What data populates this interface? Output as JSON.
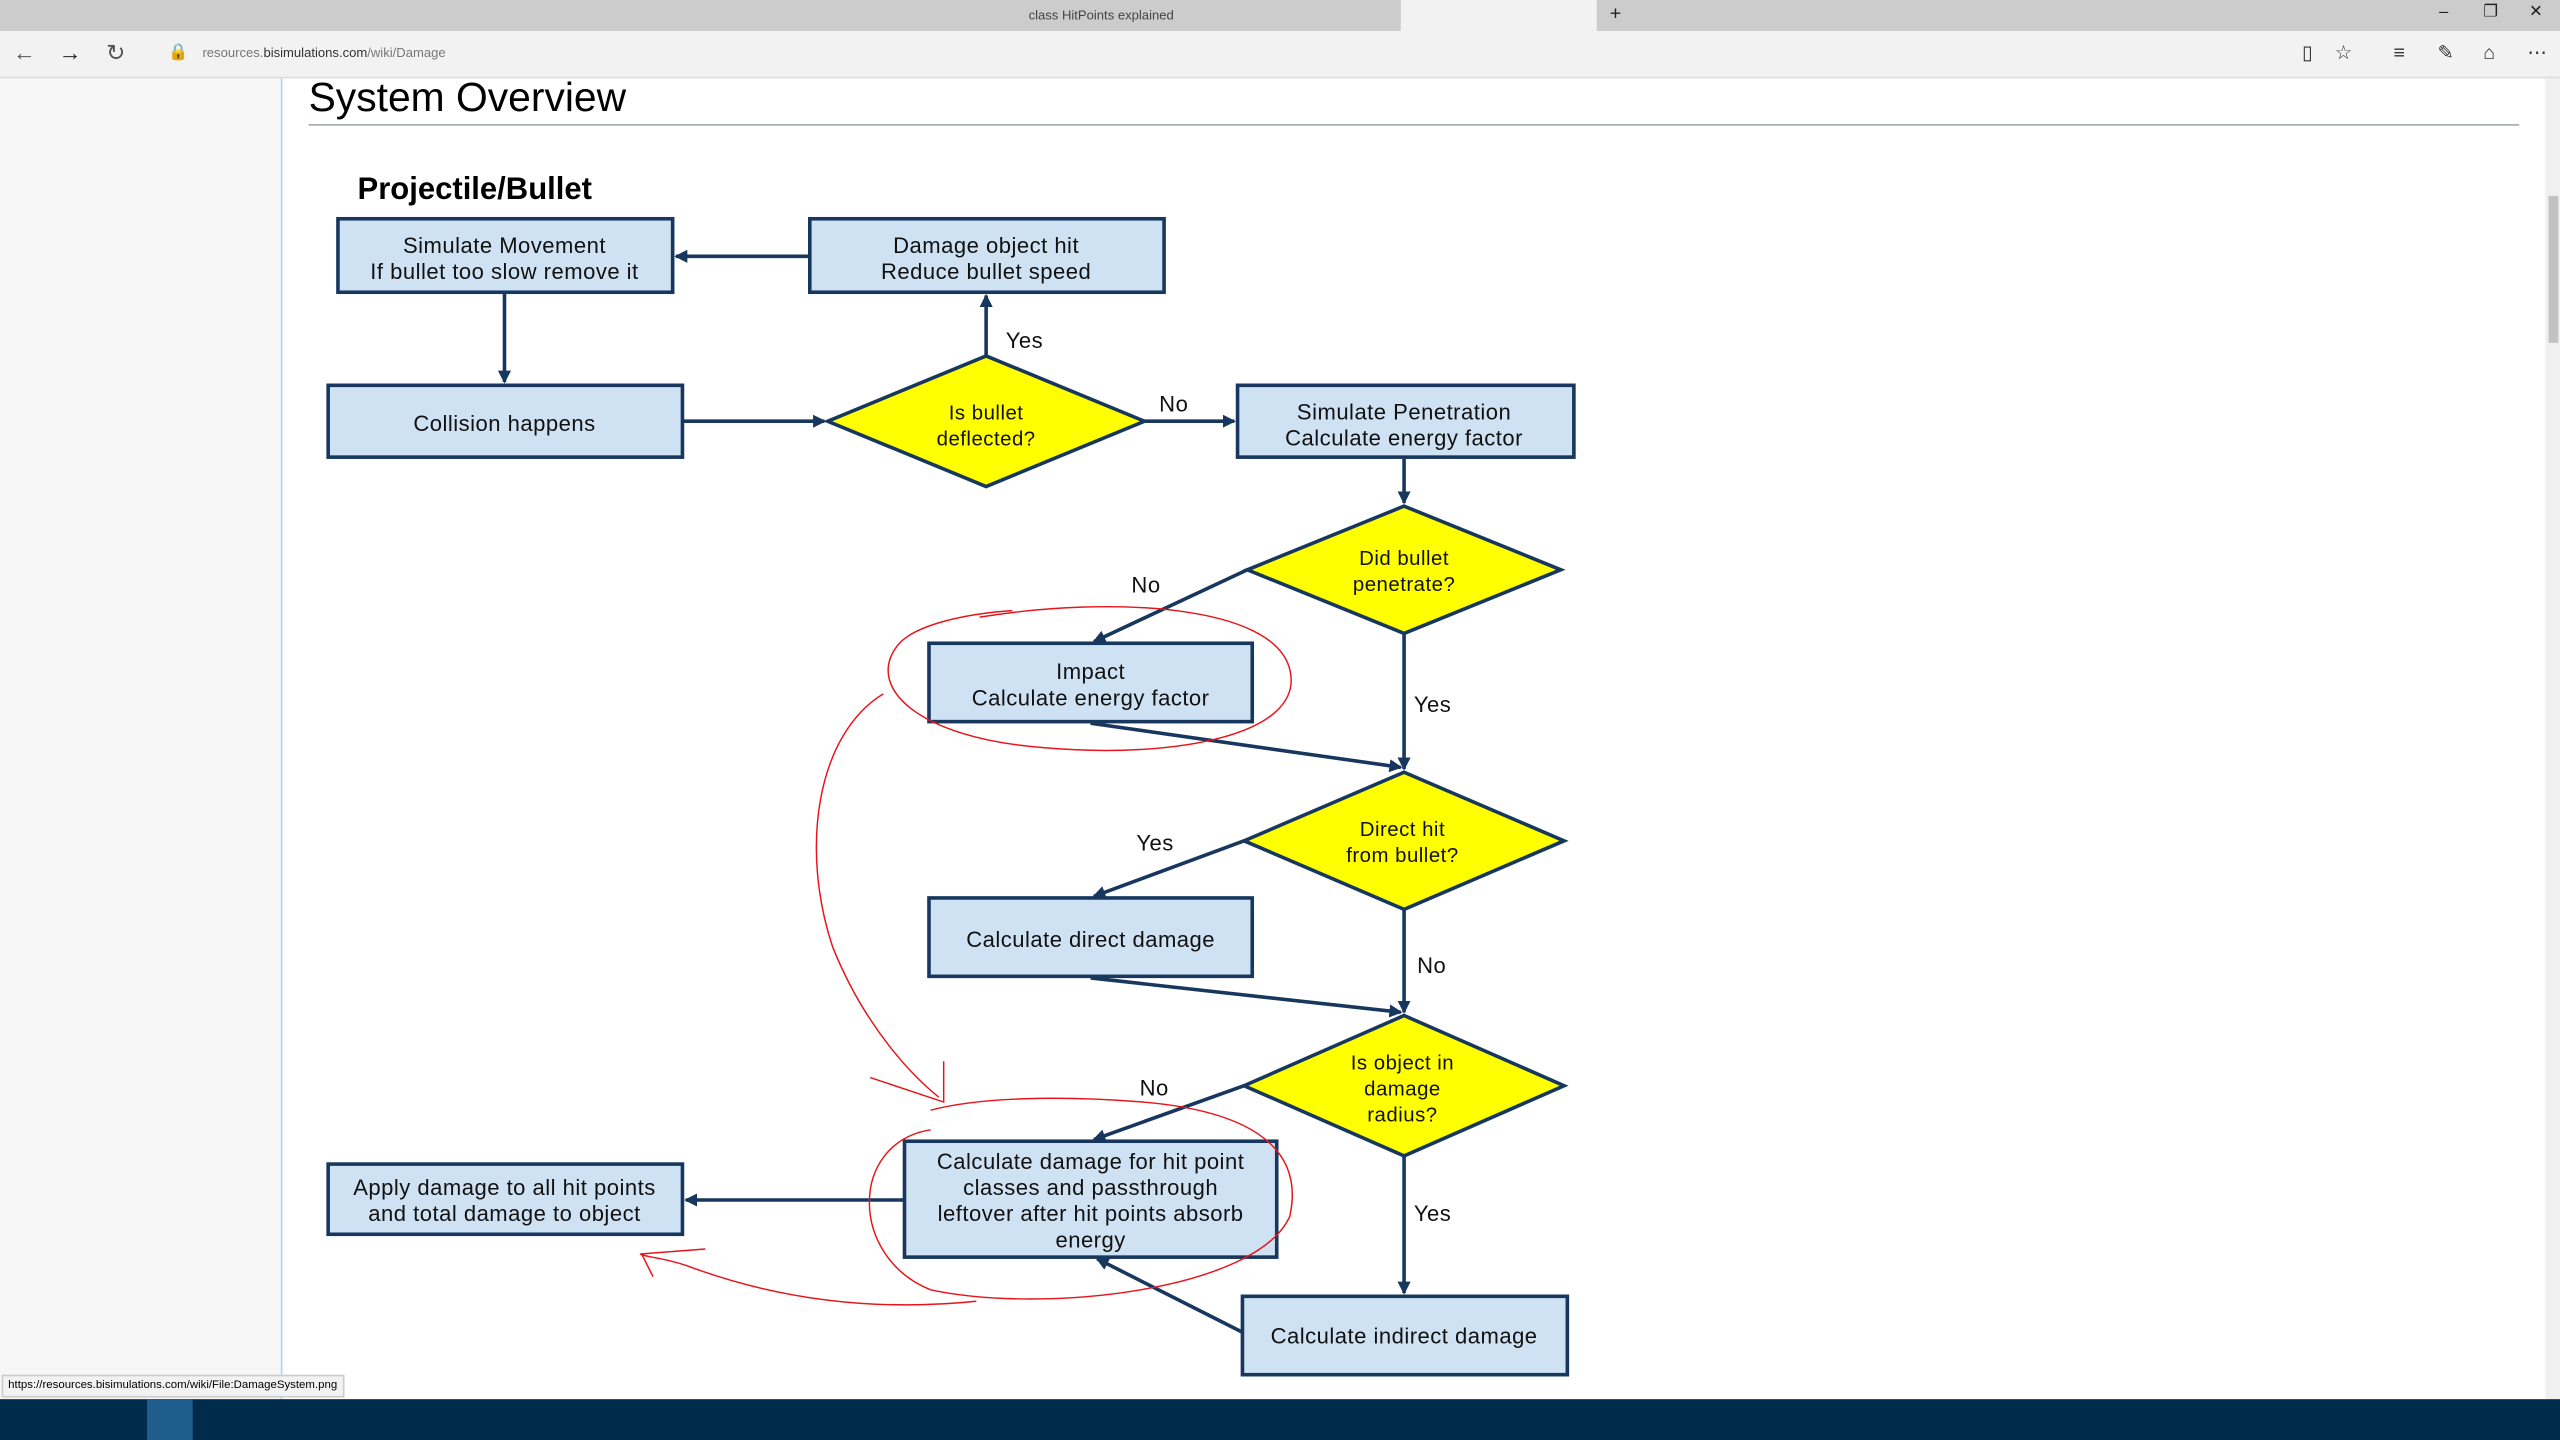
{
  "browser": {
    "tabs": [
      {
        "label": "class HitPoints explained"
      }
    ],
    "new_tab": "+",
    "url_prefix": "resources.",
    "url_domain": "bisimulations.com",
    "url_path": "/wiki/Damage",
    "status_url": "https://resources.bisimulations.com/wiki/File:DamageSystem.png",
    "window_controls": {
      "minimize": "–",
      "restore": "❐",
      "close": "✕"
    }
  },
  "page": {
    "title": "System Overview",
    "diagram_title": "Projectile/Bullet"
  },
  "diagram": {
    "nodes": {
      "simulate_movement": [
        "Simulate Movement",
        "If bullet too slow remove it"
      ],
      "damage_object_hit": [
        "Damage object hit",
        "Reduce bullet speed"
      ],
      "collision_happens": [
        "Collision happens"
      ],
      "is_deflected": [
        "Is bullet",
        "deflected?"
      ],
      "simulate_penetration": [
        "Simulate Penetration",
        "Calculate energy factor"
      ],
      "did_penetrate": [
        "Did bullet",
        "penetrate?"
      ],
      "impact": [
        "Impact",
        "Calculate energy factor"
      ],
      "direct_hit": [
        "Direct hit",
        "from bullet?"
      ],
      "calc_direct": [
        "Calculate direct damage"
      ],
      "in_radius": [
        "Is object in",
        "damage",
        "radius?"
      ],
      "calc_hitpoint": [
        "Calculate damage for hit point",
        "classes and passthrough",
        "leftover after hit points absorb",
        "energy"
      ],
      "apply_damage": [
        "Apply damage to all hit points",
        "and total damage to object"
      ],
      "calc_indirect": [
        "Calculate indirect damage"
      ]
    },
    "edge_labels": {
      "deflected_yes": "Yes",
      "deflected_no": "No",
      "penetrate_no": "No",
      "penetrate_yes": "Yes",
      "direct_yes": "Yes",
      "direct_no": "No",
      "radius_no": "No",
      "radius_yes": "Yes"
    },
    "colors": {
      "box_fill": "#cfe2f3",
      "box_stroke": "#17375e",
      "decision_fill": "#ffff00",
      "annotation": "#e8141b"
    }
  }
}
